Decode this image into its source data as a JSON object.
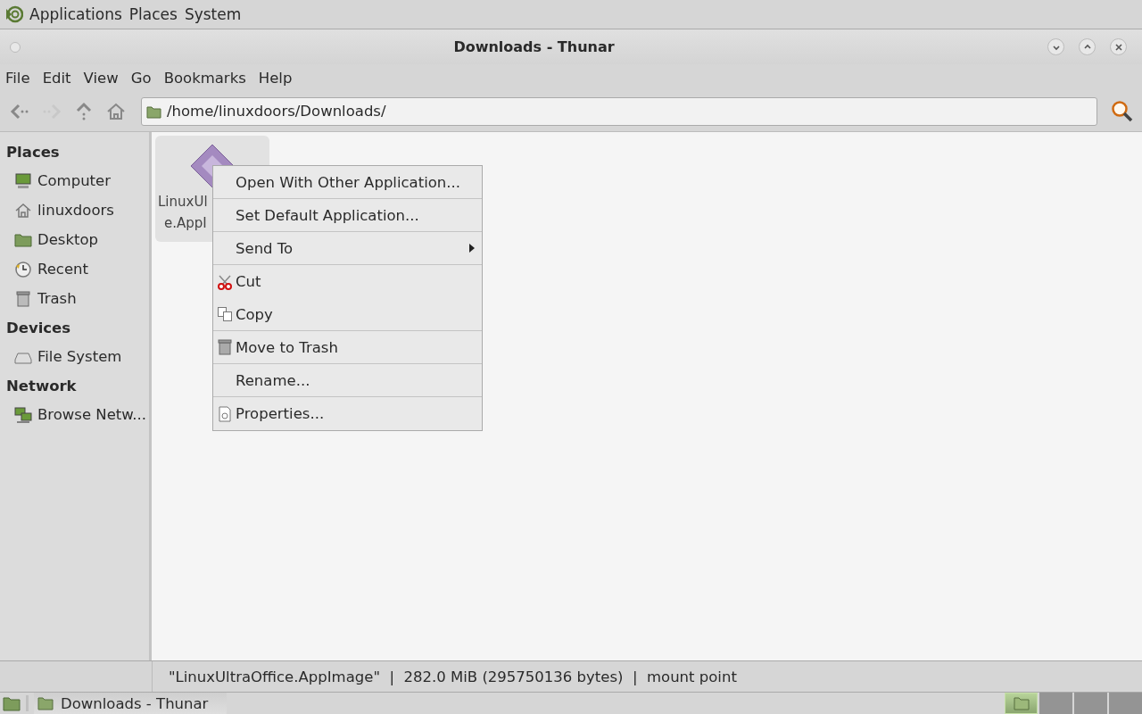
{
  "top_panel": {
    "menus": [
      "Applications",
      "Places",
      "System"
    ]
  },
  "window": {
    "title": "Downloads - Thunar"
  },
  "menubar": [
    "File",
    "Edit",
    "View",
    "Go",
    "Bookmarks",
    "Help"
  ],
  "toolbar": {
    "buttons": [
      {
        "kind": "back",
        "disabled": false
      },
      {
        "kind": "forward",
        "disabled": true
      },
      {
        "kind": "up",
        "disabled": false
      },
      {
        "kind": "home",
        "disabled": false
      }
    ],
    "location": "/home/linuxdoors/Downloads/"
  },
  "sidebar": [
    {
      "heading": "Places",
      "items": [
        {
          "label": "Computer",
          "kind": "computer"
        },
        {
          "label": "linuxdoors",
          "kind": "home"
        },
        {
          "label": "Desktop",
          "kind": "folder"
        },
        {
          "label": "Recent",
          "kind": "recent"
        },
        {
          "label": "Trash",
          "kind": "trash"
        }
      ]
    },
    {
      "heading": "Devices",
      "items": [
        {
          "label": "File System",
          "kind": "drive"
        }
      ]
    },
    {
      "heading": "Network",
      "items": [
        {
          "label": "Browse Netw...",
          "kind": "network"
        }
      ]
    }
  ],
  "files": [
    {
      "label_lines": [
        "LinuxUl",
        "e.AppI"
      ],
      "selected": true
    }
  ],
  "context_menu": [
    {
      "label": "Open With Other Application...",
      "kind": "plain",
      "submenu": false
    },
    {
      "label": "Set Default Application...",
      "kind": "plain",
      "submenu": false
    },
    {
      "label": "Send To",
      "kind": "plain",
      "submenu": true
    },
    {
      "label": "Cut",
      "kind": "cut",
      "submenu": false
    },
    {
      "label": "Copy",
      "kind": "copy",
      "submenu": false
    },
    {
      "label": "Move to Trash",
      "kind": "trash",
      "submenu": false
    },
    {
      "label": "Rename...",
      "kind": "plain",
      "submenu": false
    },
    {
      "label": "Properties...",
      "kind": "properties",
      "submenu": false
    }
  ],
  "status_bar": "\"LinuxUltraOffice.AppImage\"  |  282.0 MiB (295750136 bytes)  |  mount point",
  "taskbar": {
    "tasks": [
      {
        "label": "Downloads - Thunar",
        "selected": false
      }
    ],
    "workspaces": [
      {
        "selected": true
      },
      {
        "selected": false
      },
      {
        "selected": false
      },
      {
        "selected": false
      }
    ]
  }
}
